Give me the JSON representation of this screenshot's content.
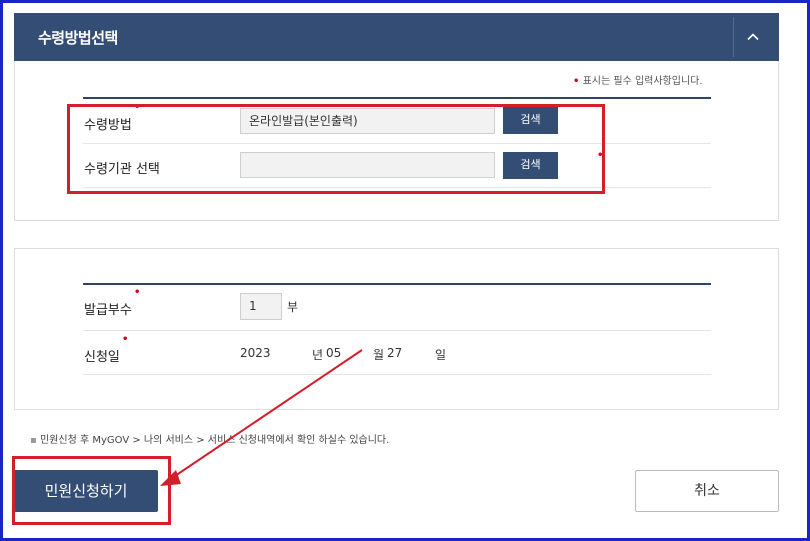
{
  "section": {
    "title": "수령방법선택",
    "required_note": "표시는 필수 입력사항입니다."
  },
  "receipt": {
    "method_label": "수령방법",
    "method_value": "온라인발급(본인출력)",
    "search_label_1": "검색",
    "agency_label": "수령기관 선택",
    "agency_value": "",
    "search_label_2": "검색"
  },
  "issue": {
    "copies_label": "발급부수",
    "copies_value": "1",
    "copies_unit": "부",
    "date_label": "신청일",
    "year": "2023",
    "year_unit": "년",
    "month": "05",
    "month_unit": "월",
    "day": "27",
    "day_unit": "일"
  },
  "footer": {
    "note": "민원신청 후 MyGOV > 나의 서비스 > 서비스 신청내역에서 확인 하실수 있습니다.",
    "submit_label": "민원신청하기",
    "cancel_label": "취소"
  },
  "colors": {
    "navy": "#344d75",
    "highlight_red": "#d31f2a",
    "frame_blue": "#1726c8"
  }
}
